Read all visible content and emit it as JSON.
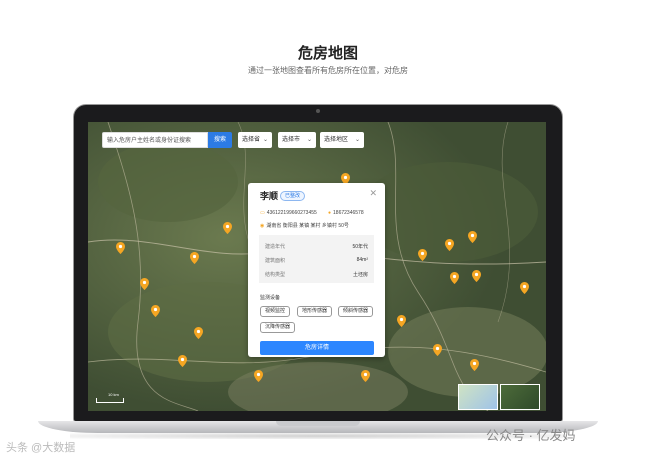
{
  "page": {
    "title": "危房地图",
    "subtitle": "通过一张地图查看所有危房所在位置，对危房"
  },
  "map": {
    "search": {
      "placeholder": "输入危房户主姓名或身份证搜索",
      "button": "搜索"
    },
    "selects": [
      {
        "label": "选择省"
      },
      {
        "label": "选择市"
      },
      {
        "label": "选择地区"
      }
    ],
    "pin_color": "#f5a623",
    "scale_label": "10 km"
  },
  "popup": {
    "name": "李顺",
    "badge": "已整改",
    "id_number": "4361221996602734​55",
    "phone": "18672346578",
    "address": "湖南省 衡阳县 某镇 某村 乡镇村 50号",
    "info": [
      {
        "label": "建造年代",
        "value": "50年代"
      },
      {
        "label": "建筑面积",
        "value": "84m²"
      },
      {
        "label": "结构类型",
        "value": "土坯房"
      }
    ],
    "section_title": "监测设备",
    "tags": [
      "视频监控",
      "地形传感器",
      "倾斜传感器",
      "沉降传感器"
    ],
    "detail_button": "危房详情"
  },
  "watermark": {
    "left": "头条 @大数据",
    "right": "公众号 · 亿发妈"
  }
}
